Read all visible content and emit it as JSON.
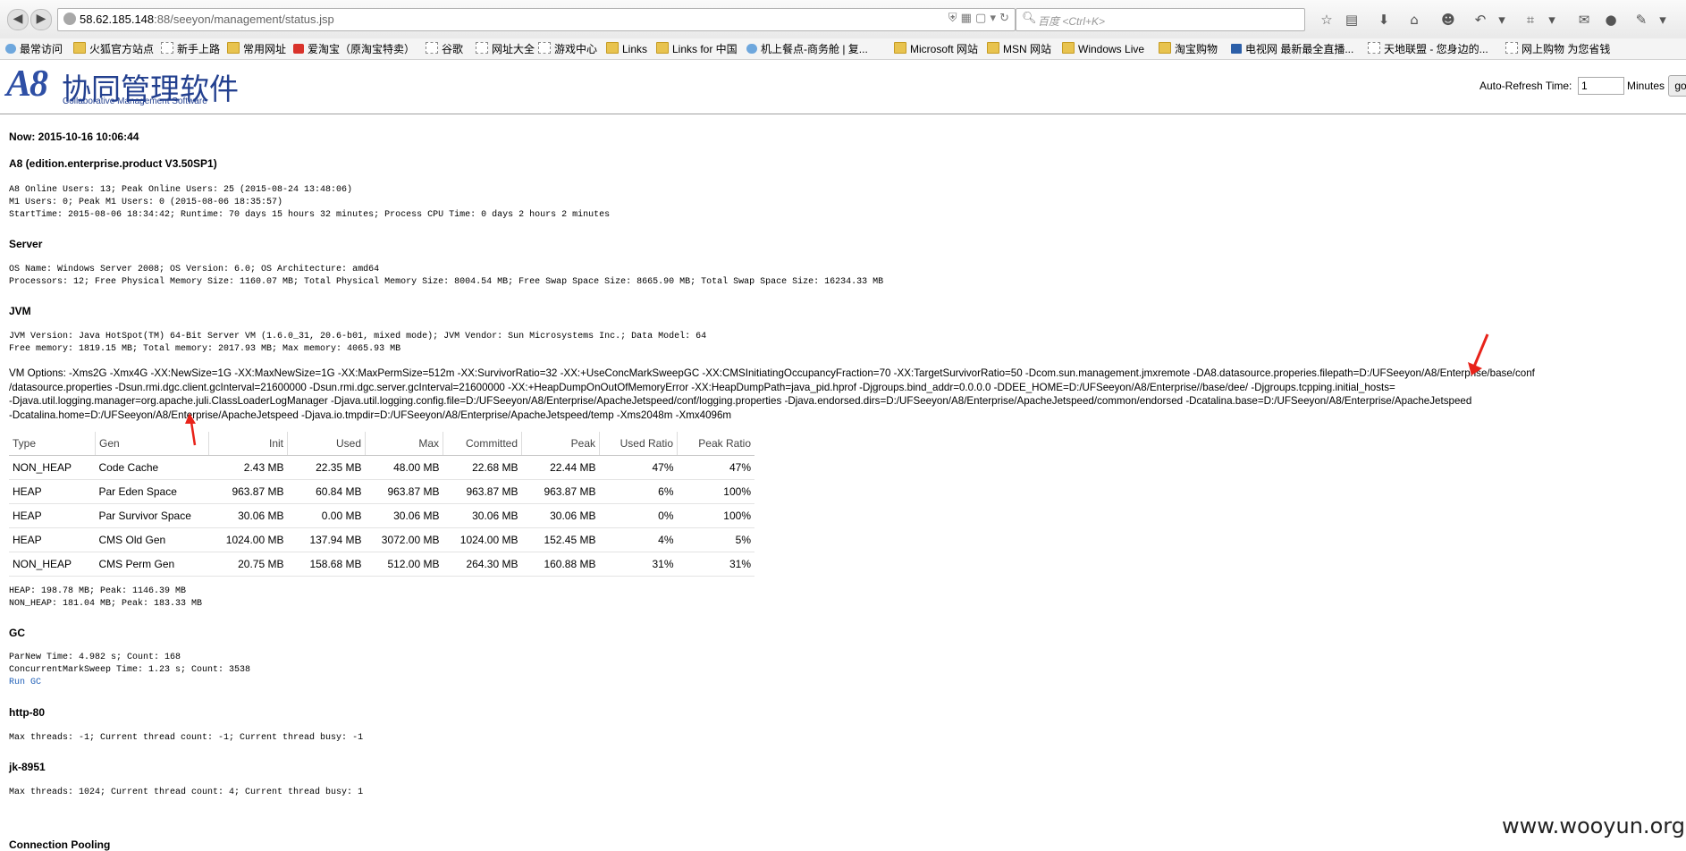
{
  "browser": {
    "url_host": "58.62.185.148",
    "url_path": ":88/seeyon/management/status.jsp",
    "search_placeholder": "百度 <Ctrl+K>",
    "bookmarks": [
      {
        "label": "最常访问",
        "icon": "globe"
      },
      {
        "label": "火狐官方站点",
        "icon": "folder"
      },
      {
        "label": "新手上路",
        "icon": "page"
      },
      {
        "label": "常用网址",
        "icon": "folder"
      },
      {
        "label": "爱淘宝（原淘宝特卖）",
        "icon": "red"
      },
      {
        "label": "谷歌",
        "icon": "page"
      },
      {
        "label": "网址大全",
        "icon": "page"
      },
      {
        "label": "游戏中心",
        "icon": "page"
      },
      {
        "label": "Links",
        "icon": "folder"
      },
      {
        "label": "Links for 中国",
        "icon": "folder"
      },
      {
        "label": "机上餐点-商务舱 | 复...",
        "icon": "globe"
      },
      {
        "label": "Microsoft 网站",
        "icon": "folder"
      },
      {
        "label": "MSN 网站",
        "icon": "folder"
      },
      {
        "label": "Windows Live",
        "icon": "folder"
      },
      {
        "label": "淘宝购物",
        "icon": "folder"
      },
      {
        "label": "电视网 最新最全直播...",
        "icon": "tv"
      },
      {
        "label": "天地联盟 - 您身边的...",
        "icon": "page"
      },
      {
        "label": "网上购物 为您省钱",
        "icon": "page"
      }
    ]
  },
  "header": {
    "logo_mark": "A8",
    "logo_cn": "协同管理软件",
    "logo_en": "Collaborative Management Software",
    "refresh_label": "Auto-Refresh Time:",
    "refresh_value": "1",
    "refresh_unit": "Minutes",
    "go_label": "go"
  },
  "content": {
    "now": "Now: 2015-10-16 10:06:44",
    "edition": "A8 (edition.enterprise.product V3.50SP1)",
    "users_1": "A8 Online Users: 13; Peak Online Users: 25 (2015-08-24 13:48:06)",
    "users_2": "M1 Users: 0; Peak M1 Users: 0 (2015-08-06 18:35:57)",
    "users_3": "StartTime: 2015-08-06 18:34:42; Runtime: 70 days 15 hours 32 minutes; Process CPU Time: 0 days 2 hours 2 minutes",
    "server_title": "Server",
    "server_1": "OS Name: Windows Server 2008; OS Version: 6.0; OS Architecture: amd64",
    "server_2": "Processors: 12; Free Physical Memory Size: 1160.07 MB; Total Physical Memory Size: 8004.54 MB; Free Swap Space Size: 8665.90 MB; Total Swap Space Size: 16234.33 MB",
    "jvm_title": "JVM",
    "jvm_1": "JVM Version: Java HotSpot(TM) 64-Bit Server VM (1.6.0_31, 20.6-b01, mixed mode); JVM Vendor: Sun Microsystems Inc.; Data Model: 64",
    "jvm_2": "Free memory: 1819.15 MB; Total memory: 2017.93 MB; Max memory: 4065.93 MB",
    "vm_options": [
      "VM Options: -Xms2G -Xmx4G -XX:NewSize=1G -XX:MaxNewSize=1G -XX:MaxPermSize=512m -XX:SurvivorRatio=32 -XX:+UseConcMarkSweepGC -XX:CMSInitiatingOccupancyFraction=70 -XX:TargetSurvivorRatio=50 -Dcom.sun.management.jmxremote -DA8.datasource.properies.filepath=D:/UFSeeyon/A8/Enterprise/base/conf",
      "/datasource.properties -Dsun.rmi.dgc.client.gcInterval=21600000 -Dsun.rmi.dgc.server.gcInterval=21600000 -XX:+HeapDumpOnOutOfMemoryError -XX:HeapDumpPath=java_pid.hprof -Djgroups.bind_addr=0.0.0.0 -DDEE_HOME=D:/UFSeeyon/A8/Enterprise//base/dee/ -Djgroups.tcpping.initial_hosts=",
      "-Djava.util.logging.manager=org.apache.juli.ClassLoaderLogManager -Djava.util.logging.config.file=D:/UFSeeyon/A8/Enterprise/ApacheJetspeed/conf/logging.properties -Djava.endorsed.dirs=D:/UFSeeyon/A8/Enterprise/ApacheJetspeed/common/endorsed -Dcatalina.base=D:/UFSeeyon/A8/Enterprise/ApacheJetspeed",
      "-Dcatalina.home=D:/UFSeeyon/A8/Enterprise/ApacheJetspeed -Djava.io.tmpdir=D:/UFSeeyon/A8/Enterprise/ApacheJetspeed/temp -Xms2048m -Xmx4096m"
    ],
    "mem_headers": [
      "Type",
      "Gen",
      "Init",
      "Used",
      "Max",
      "Committed",
      "Peak",
      "Used Ratio",
      "Peak Ratio"
    ],
    "mem_rows": [
      [
        "NON_HEAP",
        "Code Cache",
        "2.43 MB",
        "22.35 MB",
        "48.00 MB",
        "22.68 MB",
        "22.44 MB",
        "47%",
        "47%"
      ],
      [
        "HEAP",
        "Par Eden Space",
        "963.87 MB",
        "60.84 MB",
        "963.87 MB",
        "963.87 MB",
        "963.87 MB",
        "6%",
        "100%"
      ],
      [
        "HEAP",
        "Par Survivor Space",
        "30.06 MB",
        "0.00 MB",
        "30.06 MB",
        "30.06 MB",
        "30.06 MB",
        "0%",
        "100%"
      ],
      [
        "HEAP",
        "CMS Old Gen",
        "1024.00 MB",
        "137.94 MB",
        "3072.00 MB",
        "1024.00 MB",
        "152.45 MB",
        "4%",
        "5%"
      ],
      [
        "NON_HEAP",
        "CMS Perm Gen",
        "20.75 MB",
        "158.68 MB",
        "512.00 MB",
        "264.30 MB",
        "160.88 MB",
        "31%",
        "31%"
      ]
    ],
    "heap_1": "HEAP: 198.78 MB; Peak: 1146.39 MB",
    "heap_2": "NON_HEAP: 181.04 MB; Peak: 183.33 MB",
    "gc_title": "GC",
    "gc_1": "ParNew  Time: 4.982 s; Count: 168",
    "gc_2": "ConcurrentMarkSweep  Time: 1.23 s; Count: 3538",
    "run_gc": "Run GC",
    "http_title": "http-80",
    "http_1": "Max threads: -1; Current thread count: -1; Current thread busy: -1",
    "jk_title": "jk-8951",
    "jk_1": "Max threads: 1024; Current thread count: 4; Current thread busy: 1",
    "pool_title": "Connection Pooling"
  },
  "watermark": "www.wooyun.org",
  "colors": {
    "arrow": "#e8231a",
    "link": "#1f5fb8",
    "logo": "#2e4fa5"
  }
}
